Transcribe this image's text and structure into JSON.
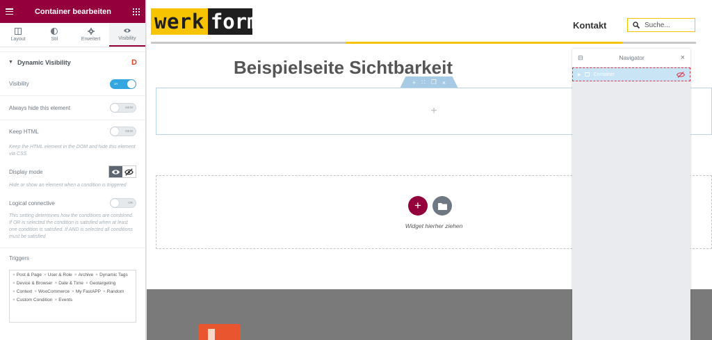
{
  "panel": {
    "title": "Container bearbeiten",
    "tabs": [
      {
        "label": "Layout",
        "icon": "columns-icon"
      },
      {
        "label": "Stil",
        "icon": "half-circle-icon"
      },
      {
        "label": "Erweitert",
        "icon": "gear-icon"
      },
      {
        "label": "Visibility",
        "icon": "eye-icon",
        "active": true
      }
    ],
    "section_title": "Dynamic Visibility",
    "section_badge": "D",
    "controls": {
      "visibility": {
        "label": "Visibility",
        "state": "JA"
      },
      "always_hide": {
        "label": "Always hide this element",
        "state": "NEIN"
      },
      "keep_html": {
        "label": "Keep HTML",
        "state": "NEIN",
        "hint": "Keep the HTML element in the DOM and hide this element via CSS"
      },
      "display_mode": {
        "label": "Display mode",
        "hint": "Hide or show an element when a condition is triggered"
      },
      "logical": {
        "label": "Logical connective",
        "state": "OR",
        "hint": "This setting determines how the conditions are combined. If OR is selected the condition is satisfied when at least one condition is satisfied. If AND is selected all conditions must be satisfied"
      }
    },
    "triggers_label": "Triggers",
    "triggers": [
      "Post & Page",
      "User & Role",
      "Archive",
      "Dynamic Tags",
      "Device & Browser",
      "Date & Time",
      "Geotargeting",
      "Context",
      "WooCommerce",
      "My FastAPP",
      "Random",
      "Custom Condition",
      "Events"
    ]
  },
  "site": {
    "logo_part1": "werk",
    "logo_part2": "form",
    "nav_link": "Kontakt",
    "search_placeholder": "Suche...",
    "page_title": "Beispielseite Sichtbarkeit",
    "dropzone_text": "Widget hierher ziehen"
  },
  "navigator": {
    "title": "Navigator",
    "items": [
      {
        "label": "Container",
        "hidden": true
      }
    ]
  },
  "colors": {
    "brand": "#93003c",
    "accent_yellow": "#f6c400",
    "switch_on": "#34a6e0"
  }
}
